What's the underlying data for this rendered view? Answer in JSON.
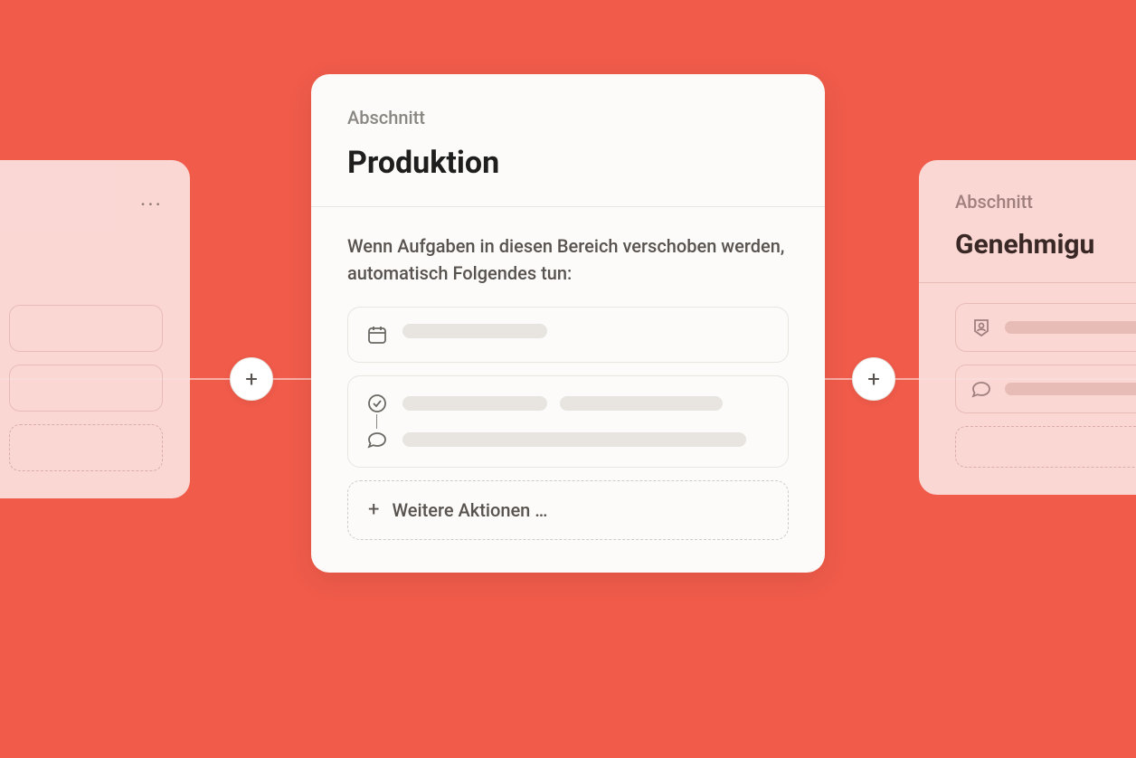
{
  "colors": {
    "background": "#f05b4a",
    "cardBg": "#fcfbf9",
    "cardBgPink": "#fbe2df"
  },
  "leftCard": {
    "moreLabel": "..."
  },
  "centerCard": {
    "sectionLabel": "Abschnitt",
    "title": "Produktion",
    "description": "Wenn Aufgaben in diesen Bereich verschoben werden, automatisch Folgendes tun:",
    "addMoreLabel": "Weitere Aktionen …",
    "addMorePlus": "+"
  },
  "rightCard": {
    "sectionLabel": "Abschnitt",
    "title": "Genehmigu"
  },
  "addButtons": {
    "plus": "+"
  }
}
